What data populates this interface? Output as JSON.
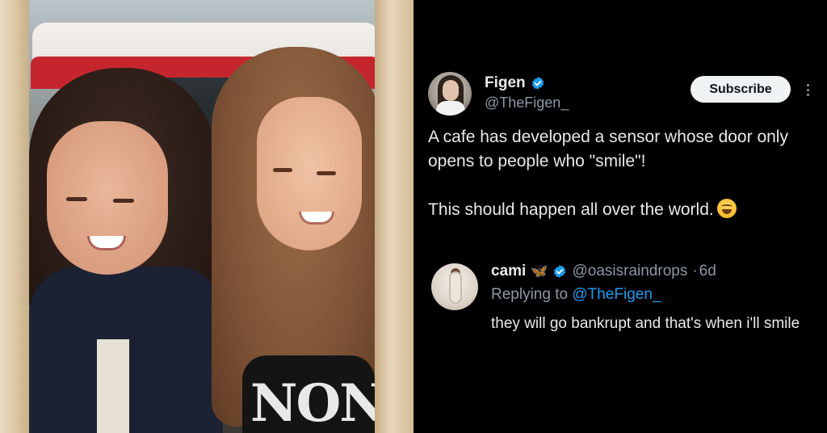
{
  "tweet": {
    "author_name": "Figen",
    "author_handle": "@TheFigen_",
    "subscribe_label": "Subscribe",
    "text_line1": "A cafe has developed a sensor whose door only opens to people who \"smile\"!",
    "text_line2": "This should happen all over the world.",
    "emoji": "grinning-sweat-emoji"
  },
  "reply": {
    "author_name": "cami",
    "name_emoji": "butterfly-emoji",
    "author_handle": "@oasisraindrops",
    "separator": "·",
    "age": "6d",
    "replying_prefix": "Replying to",
    "replying_handle": "@TheFigen_",
    "text": "they will go bankrupt and that's when i'll smile"
  },
  "photo": {
    "shirt_print": "NON"
  },
  "colors": {
    "background": "#000000",
    "text_primary": "#e7e9ea",
    "text_secondary": "#8b98a5",
    "link": "#1d9bf0",
    "verified": "#1d9bf0",
    "subscribe_bg": "#eff3f4"
  }
}
